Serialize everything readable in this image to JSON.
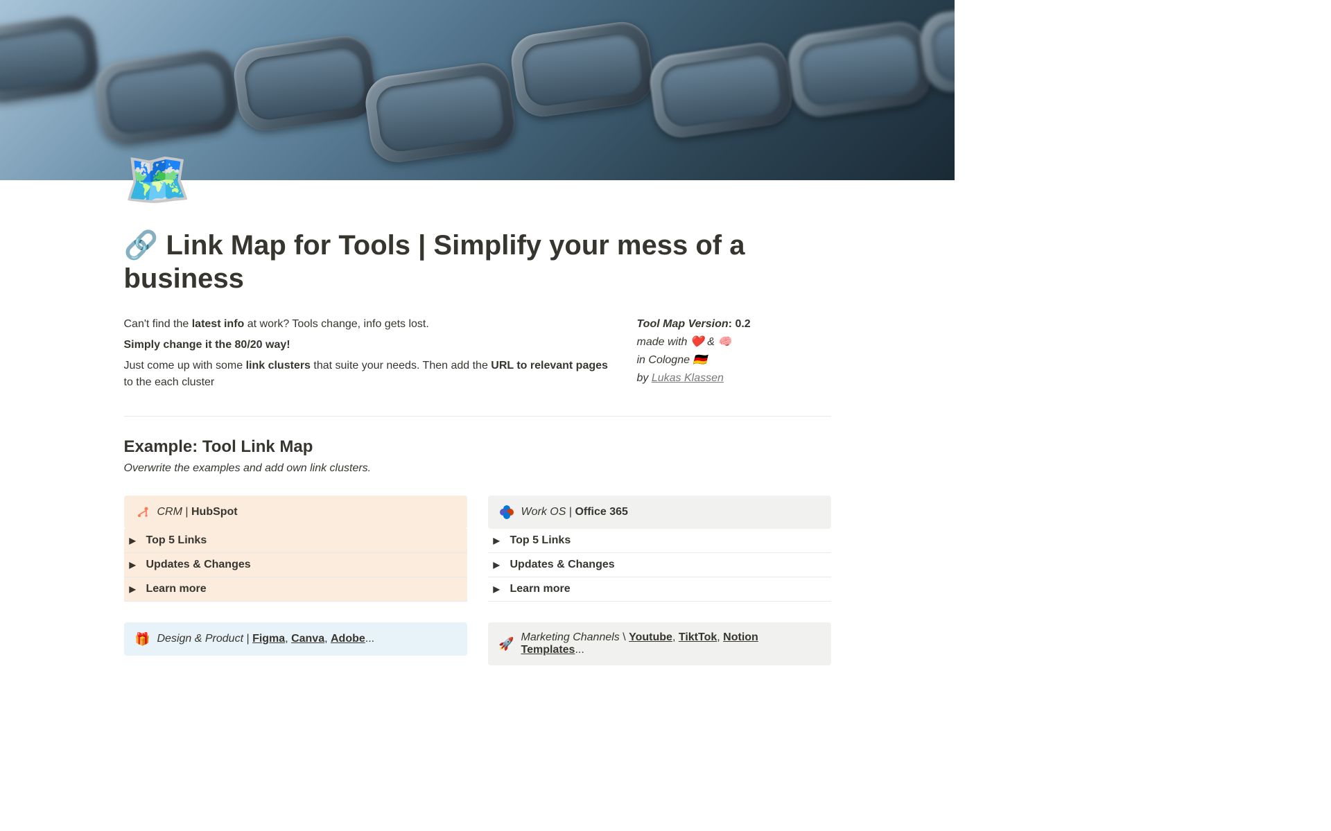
{
  "page": {
    "icon": "🗺️",
    "title_icon": "🔗",
    "title": "Link Map for Tools | Simplify your mess of a business"
  },
  "intro": {
    "line1_pre": "Can't find the ",
    "line1_bold": "latest info",
    "line1_post": " at work? Tools change, info gets lost.",
    "line2": "Simply change it the 80/20 way!",
    "line3_pre": "Just come up with some ",
    "line3_bold1": "link clusters",
    "line3_mid": " that suite your needs. Then add the ",
    "line3_bold2": "URL to relevant pages",
    "line3_post": " to the each cluster"
  },
  "meta": {
    "version_label": "Tool Map Version",
    "version": "0.2",
    "made_with": "made with ❤️ & 🧠",
    "location": "in Cologne 🇩🇪",
    "by_label": "by ",
    "author": "Lukas Klassen"
  },
  "example": {
    "title": "Example: Tool Link Map",
    "subtitle": "Overwrite the examples and add own link clusters."
  },
  "clusters": [
    {
      "category": "CRM",
      "name": "HubSpot",
      "toggles": [
        "Top 5 Links",
        "Updates & Changes",
        "Learn more"
      ]
    },
    {
      "category": "Work OS",
      "name": "Office 365",
      "toggles": [
        "Top 5 Links",
        "Updates & Changes",
        "Learn more"
      ]
    },
    {
      "category": "Design & Product",
      "links": [
        "Figma",
        "Canva",
        "Adobe"
      ],
      "ellipsis": "..."
    },
    {
      "category": "Marketing Channels",
      "links": [
        "Youtube",
        "TiktTok",
        "Notion Templates"
      ],
      "ellipsis": "..."
    }
  ]
}
